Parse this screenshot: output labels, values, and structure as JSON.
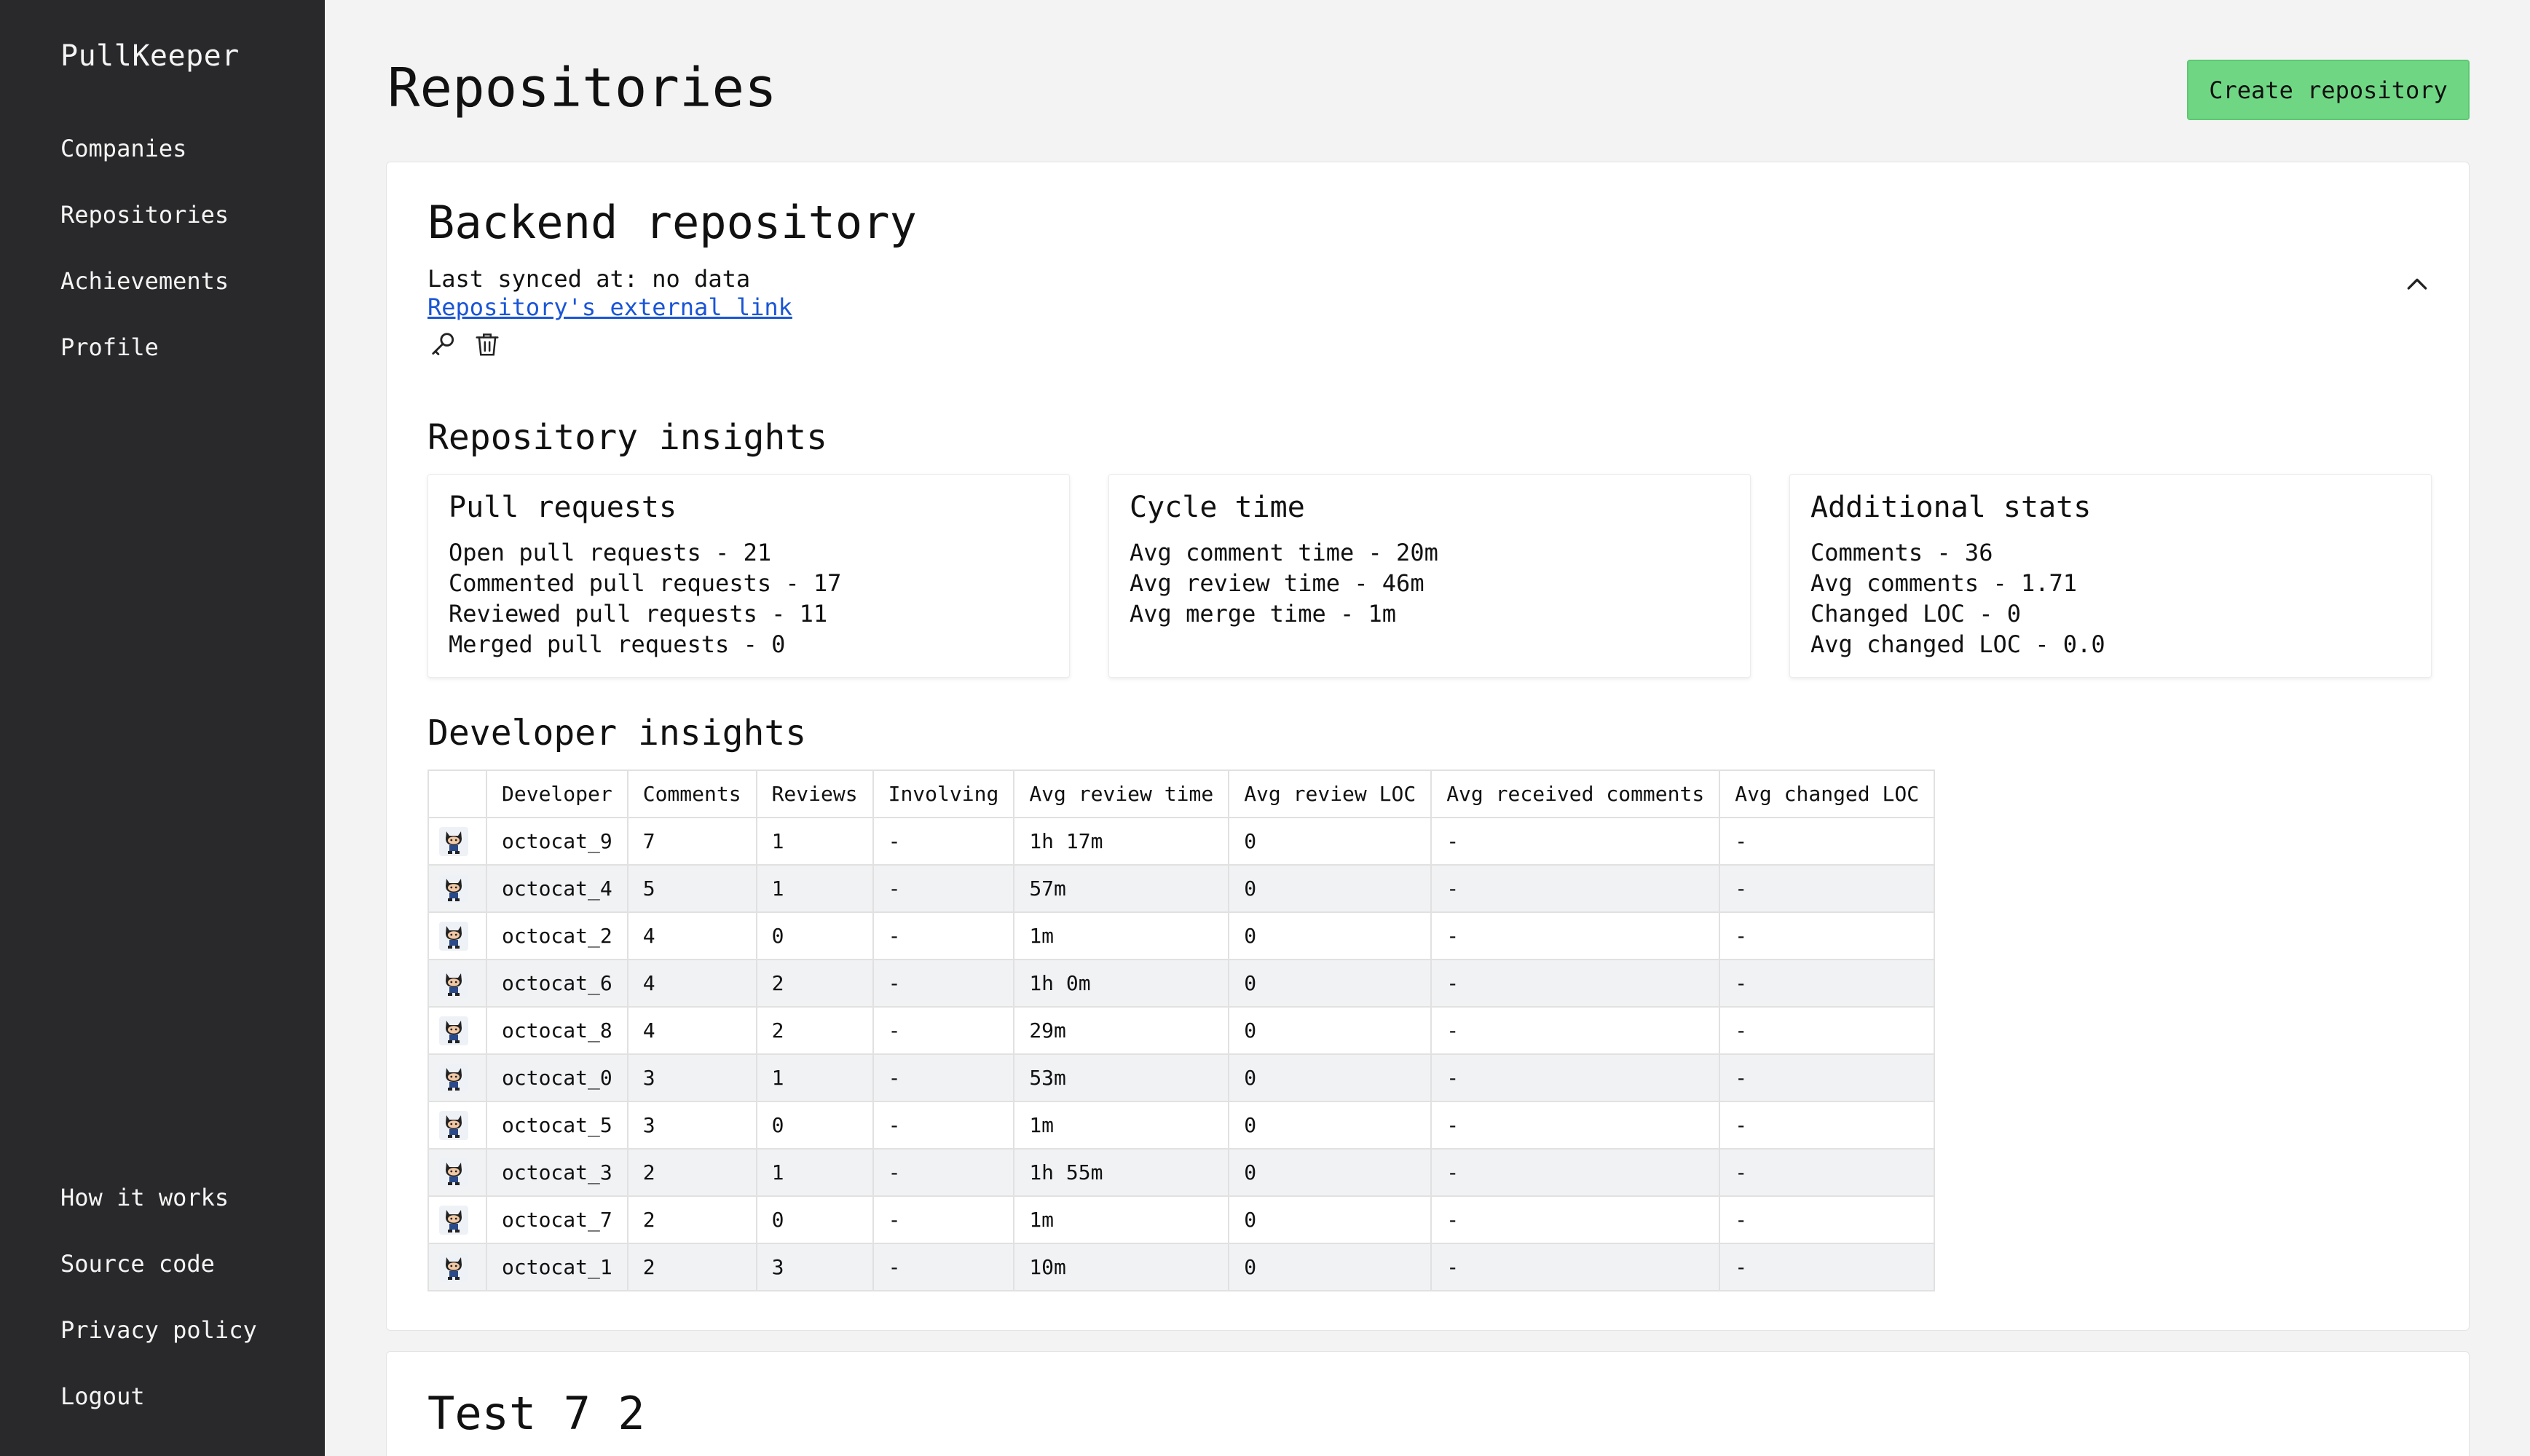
{
  "app": {
    "title": "PullKeeper"
  },
  "sidebar": {
    "top_items": [
      {
        "label": "Companies"
      },
      {
        "label": "Repositories"
      },
      {
        "label": "Achievements"
      },
      {
        "label": "Profile"
      }
    ],
    "bottom_items": [
      {
        "label": "How it works"
      },
      {
        "label": "Source code"
      },
      {
        "label": "Privacy policy"
      },
      {
        "label": "Logout"
      }
    ]
  },
  "header": {
    "title": "Repositories",
    "create_label": "Create repository"
  },
  "repo": {
    "name": "Backend repository",
    "synced": "Last synced at: no data",
    "external_link": "Repository's external link",
    "insights_title": "Repository insights",
    "boxes": [
      {
        "title": "Pull requests",
        "lines": [
          "Open pull requests - 21",
          "Commented pull requests - 17",
          "Reviewed pull requests - 11",
          "Merged pull requests - 0"
        ]
      },
      {
        "title": "Cycle time",
        "lines": [
          "Avg comment time - 20m",
          "Avg review time - 46m",
          "Avg merge time - 1m"
        ]
      },
      {
        "title": "Additional stats",
        "lines": [
          "Comments - 36",
          "Avg comments - 1.71",
          "Changed LOC - 0",
          "Avg changed LOC - 0.0"
        ]
      }
    ],
    "developer_title": "Developer insights",
    "table": {
      "headers": [
        "",
        "Developer",
        "Comments",
        "Reviews",
        "Involving",
        "Avg review time",
        "Avg review LOC",
        "Avg received comments",
        "Avg changed LOC"
      ],
      "rows": [
        [
          "octocat_9",
          "7",
          "1",
          "-",
          "1h 17m",
          "0",
          "-",
          "-"
        ],
        [
          "octocat_4",
          "5",
          "1",
          "-",
          "57m",
          "0",
          "-",
          "-"
        ],
        [
          "octocat_2",
          "4",
          "0",
          "-",
          "1m",
          "0",
          "-",
          "-"
        ],
        [
          "octocat_6",
          "4",
          "2",
          "-",
          "1h 0m",
          "0",
          "-",
          "-"
        ],
        [
          "octocat_8",
          "4",
          "2",
          "-",
          "29m",
          "0",
          "-",
          "-"
        ],
        [
          "octocat_0",
          "3",
          "1",
          "-",
          "53m",
          "0",
          "-",
          "-"
        ],
        [
          "octocat_5",
          "3",
          "0",
          "-",
          "1m",
          "0",
          "-",
          "-"
        ],
        [
          "octocat_3",
          "2",
          "1",
          "-",
          "1h 55m",
          "0",
          "-",
          "-"
        ],
        [
          "octocat_7",
          "2",
          "0",
          "-",
          "1m",
          "0",
          "-",
          "-"
        ],
        [
          "octocat_1",
          "2",
          "3",
          "-",
          "10m",
          "0",
          "-",
          "-"
        ]
      ]
    }
  },
  "repo2": {
    "name": "Test 7 2"
  },
  "icons": {
    "edit": "key-icon",
    "delete": "trash-icon",
    "collapse": "chevron-up-icon",
    "avatar": "octocat-avatar-icon"
  },
  "colors": {
    "sidebar": "#29292b",
    "accent_button": "#6fd784",
    "link": "#1a55d6"
  }
}
